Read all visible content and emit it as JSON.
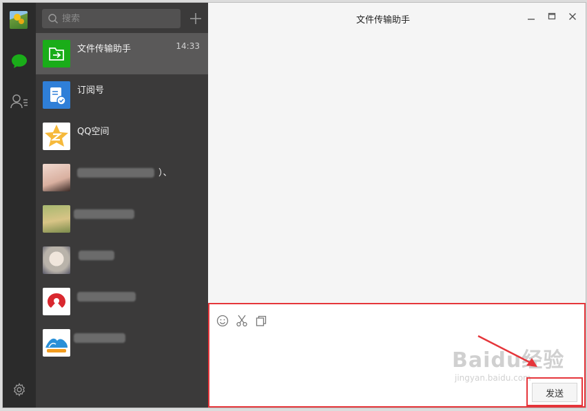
{
  "window": {
    "title": "文件传输助手"
  },
  "search": {
    "placeholder": "搜索",
    "value": ""
  },
  "chats": [
    {
      "name": "文件传输助手",
      "time": "14:33",
      "active": true,
      "icon": "file-transfer-icon"
    },
    {
      "name": "订阅号",
      "icon": "subscription-icon"
    },
    {
      "name": "QQ空间",
      "icon": "qzone-star-icon"
    },
    {
      "name": "）、",
      "redacted": true
    },
    {
      "name": "",
      "redacted": true
    },
    {
      "name": "",
      "redacted": true
    },
    {
      "name": "",
      "redacted": true
    },
    {
      "name": "",
      "redacted": true
    }
  ],
  "composer": {
    "tools": [
      "emoji-icon",
      "scissors-icon",
      "copy-icon"
    ],
    "send_label": "发送"
  },
  "watermark": {
    "text": "Baidu经验",
    "url": "jingyan.baidu.com"
  },
  "colors": {
    "rail": "#2b2b2b",
    "list": "#3b3a3a",
    "active": "#5a5959",
    "highlight": "#e5353a",
    "wechat_green": "#1aad19"
  }
}
